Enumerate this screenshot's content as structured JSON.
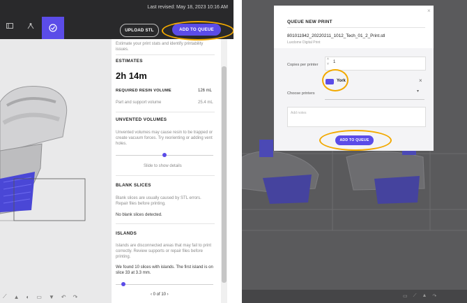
{
  "left": {
    "last_revised": "Last revised: May 18, 2023 10:16 AM",
    "upload_stl": "UPLOAD STL",
    "add_to_queue": "ADD TO QUEUE",
    "intro_text": "Estimate your print stats and identify printability issues.",
    "estimates": {
      "heading": "ESTIMATES",
      "time": "2h 14m",
      "resin_heading": "REQUIRED RESIN VOLUME",
      "resin_value": "126 mL",
      "part_label": "Part and support volume",
      "part_value": "25.4 mL"
    },
    "unvented": {
      "heading": "UNVENTED VOLUMES",
      "body": "Unvented volumes may cause resin to be trapped or create vacuum forces. Try reorienting or adding vent holes.",
      "slider_hint": "Slide to show details"
    },
    "blank": {
      "heading": "BLANK SLICES",
      "body": "Blank slices are usually caused by STL errors. Repair files before printing.",
      "result": "No blank slices detected."
    },
    "islands": {
      "heading": "ISLANDS",
      "body": "Islands are disconnected areas that may fail to print correctly. Review supports or repair files before printing.",
      "result": "We found 10 slices with islands. The first island is on slice 33 at 3.3 mm.",
      "pager": "‹   0 of 10   ›"
    }
  },
  "modal": {
    "title": "QUEUE NEW PRINT",
    "close": "×",
    "file_name": "801011942_20220211_1012_Tech_01_2_Print.stl",
    "file_sub": "Luxdome Digital Print",
    "copies_label": "Copies per printer",
    "copies_value": "1",
    "printer_chip": "",
    "printer_name": "York",
    "remove": "×",
    "printers_label": "Choose printers",
    "notes_placeholder": "Add notes",
    "add_to_queue": "ADD TO QUEUE"
  },
  "colors": {
    "accent": "#5b4ce8",
    "highlight_ring": "#f2a900",
    "topbar": "#29292b"
  }
}
